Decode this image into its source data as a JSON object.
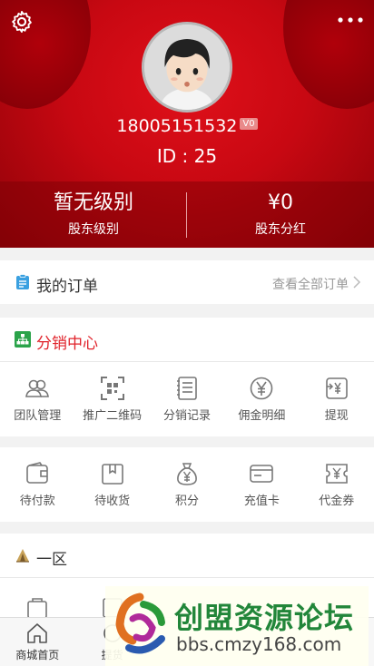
{
  "profile": {
    "phone": "18005151532",
    "badge": "V0",
    "id_line": "ID : 25"
  },
  "stats": [
    {
      "value": "暂无级别",
      "label": "股东级别"
    },
    {
      "value": "¥0",
      "label": "股东分红"
    }
  ],
  "orders": {
    "title": "我的订单",
    "link": "查看全部订单"
  },
  "distribution": {
    "title": "分销中心",
    "title_color": "#e0222a",
    "items": [
      {
        "label": "团队管理",
        "icon": "team-icon"
      },
      {
        "label": "推广二维码",
        "icon": "qrcode-icon"
      },
      {
        "label": "分销记录",
        "icon": "record-icon"
      },
      {
        "label": "佣金明细",
        "icon": "yen-coin-icon"
      },
      {
        "label": "提现",
        "icon": "withdraw-icon"
      }
    ]
  },
  "order_status": {
    "items": [
      {
        "label": "待付款",
        "icon": "wallet-icon"
      },
      {
        "label": "待收货",
        "icon": "package-icon"
      },
      {
        "label": "积分",
        "icon": "money-bag-icon"
      },
      {
        "label": "充值卡",
        "icon": "card-icon"
      },
      {
        "label": "代金券",
        "icon": "voucher-icon"
      }
    ]
  },
  "zone": {
    "title": "一区"
  },
  "tabbar": {
    "items": [
      {
        "label": "商城首页",
        "icon": "home-icon"
      },
      {
        "label": "提货",
        "icon": "pickup-icon"
      },
      {
        "label": "",
        "icon": "tab-icon"
      },
      {
        "label": "",
        "icon": "tab-icon"
      },
      {
        "label": "",
        "icon": "tab-icon"
      }
    ]
  },
  "watermark": {
    "title": "创盟资源论坛",
    "url": "bbs.cmzy168.com"
  },
  "colors": {
    "brand_red": "#d10a14",
    "accent_green": "#22863a"
  }
}
